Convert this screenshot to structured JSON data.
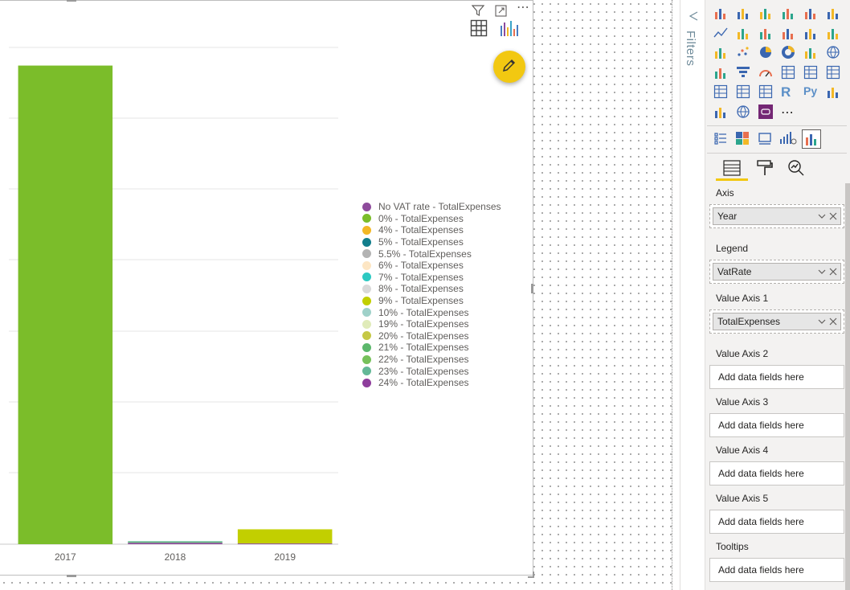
{
  "chart_data": {
    "type": "bar",
    "stacked": true,
    "categories": [
      "2017",
      "2018",
      "2019"
    ],
    "title": "",
    "xlabel": "",
    "ylabel": "",
    "ylim": [
      0,
      730
    ],
    "series": [
      {
        "name": "No VAT rate - TotalExpenses",
        "color": "#8e4b9c",
        "values": [
          0,
          2,
          1
        ]
      },
      {
        "name": "0% - TotalExpenses",
        "color": "#7bbd2a",
        "values": [
          643,
          0,
          0
        ]
      },
      {
        "name": "4% - TotalExpenses",
        "color": "#f2b826",
        "values": [
          0,
          0,
          0
        ]
      },
      {
        "name": "5% - TotalExpenses",
        "color": "#127e8c",
        "values": [
          0,
          0,
          0
        ]
      },
      {
        "name": "5.5% - TotalExpenses",
        "color": "#b3b3b3",
        "values": [
          0,
          0,
          0
        ]
      },
      {
        "name": "6% - TotalExpenses",
        "color": "#fde6c4",
        "values": [
          0,
          0,
          0
        ]
      },
      {
        "name": "7% - TotalExpenses",
        "color": "#2dc9c2",
        "values": [
          0,
          0,
          0
        ]
      },
      {
        "name": "8% - TotalExpenses",
        "color": "#d9d9d9",
        "values": [
          0,
          0,
          0
        ]
      },
      {
        "name": "9% - TotalExpenses",
        "color": "#c2cf00",
        "values": [
          0,
          0,
          19
        ]
      },
      {
        "name": "10% - TotalExpenses",
        "color": "#9fd1c9",
        "values": [
          0,
          0,
          0
        ]
      },
      {
        "name": "19% - TotalExpenses",
        "color": "#e0ebb9",
        "values": [
          0,
          0,
          0
        ]
      },
      {
        "name": "20% - TotalExpenses",
        "color": "#c5c845",
        "values": [
          0,
          0,
          0
        ]
      },
      {
        "name": "21% - TotalExpenses",
        "color": "#5cb86c",
        "values": [
          0,
          1,
          0
        ]
      },
      {
        "name": "22% - TotalExpenses",
        "color": "#76c15b",
        "values": [
          0,
          0,
          0
        ]
      },
      {
        "name": "23% - TotalExpenses",
        "color": "#64b897",
        "values": [
          0,
          1,
          0
        ]
      },
      {
        "name": "24% - TotalExpenses",
        "color": "#8e3e9c",
        "values": [
          0,
          0,
          0
        ]
      }
    ],
    "grid": true,
    "legend_position": "right"
  },
  "visual_toolbar": {
    "filter_icon": "filter-icon",
    "focus_icon": "focus-mode-icon",
    "more_label": "⋯",
    "table_icon": "table-icon",
    "analytics_icon": "analytics-icon",
    "edit_icon": "pencil-icon"
  },
  "filters_pane": {
    "label": "Filters"
  },
  "visualizations_pane": {
    "more_label": "⋯",
    "r_label": "R",
    "py_label": "Py",
    "wells": [
      {
        "label": "Axis",
        "field": "Year"
      },
      {
        "label": "Legend",
        "field": "VatRate"
      },
      {
        "label": "Value Axis 1",
        "field": "TotalExpenses"
      },
      {
        "label": "Value Axis 2",
        "placeholder": "Add data fields here"
      },
      {
        "label": "Value Axis 3",
        "placeholder": "Add data fields here"
      },
      {
        "label": "Value Axis 4",
        "placeholder": "Add data fields here"
      },
      {
        "label": "Value Axis 5",
        "placeholder": "Add data fields here"
      },
      {
        "label": "Tooltips",
        "placeholder": "Add data fields here"
      }
    ]
  },
  "colors": {
    "accent": "#f2c811",
    "pane_bg": "#f3f2f1",
    "filters_text": "#6f8b9a"
  }
}
